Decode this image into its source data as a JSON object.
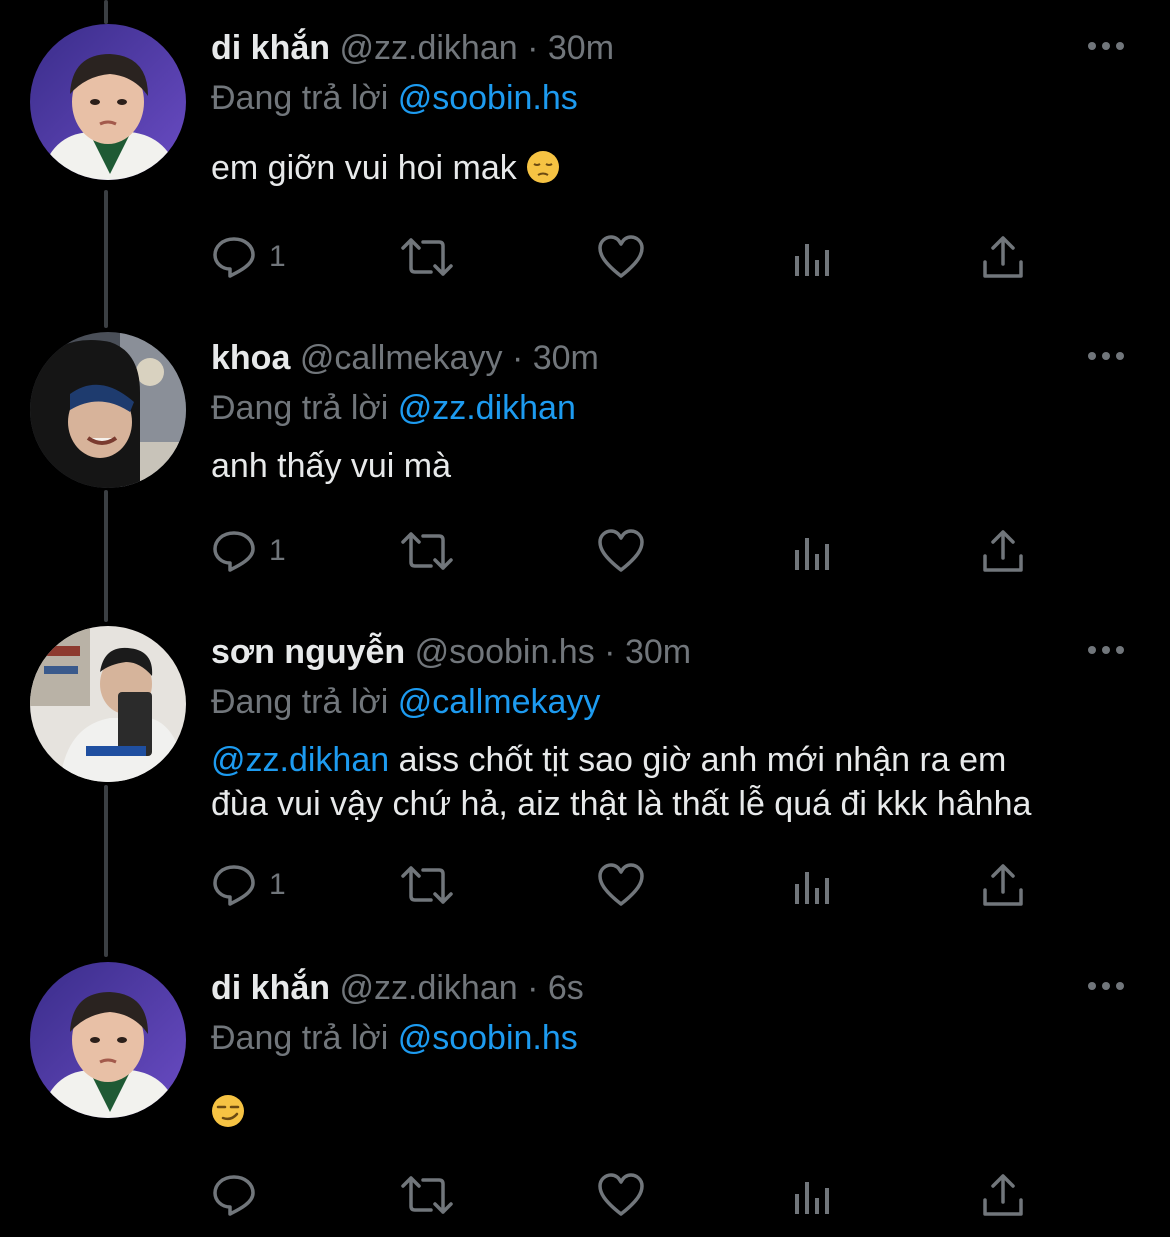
{
  "colors": {
    "background": "#000000",
    "text": "#e7e9ea",
    "muted": "#71767b",
    "mention": "#1d9bf0",
    "thread_line": "#3b3f43"
  },
  "tweets": [
    {
      "display_name": "di khắn",
      "handle": "@zz.dikhan",
      "separator": "·",
      "time": "30m",
      "reply_prefix": "Đang trả lời",
      "reply_to": "@soobin.hs",
      "text": "em giỡn vui hoi mak",
      "emoji": "pensive-face",
      "reply_count": "1",
      "avatar": "avatar-dikhan"
    },
    {
      "display_name": "khoa",
      "handle": "@callmekayy",
      "separator": "·",
      "time": "30m",
      "reply_prefix": "Đang trả lời",
      "reply_to": "@zz.dikhan",
      "text": "anh thấy vui mà",
      "reply_count": "1",
      "avatar": "avatar-khoa"
    },
    {
      "display_name": "sơn nguyễn",
      "handle": "@soobin.hs",
      "separator": "·",
      "time": "30m",
      "reply_prefix": "Đang trả lời",
      "reply_to": "@callmekayy",
      "text_mention": "@zz.dikhan",
      "text_line1": " aiss chốt tịt sao giờ anh mới nhận ra em",
      "text_line2": "đùa vui vậy chứ hả, aiz thật là thất lễ quá đi kkk hâhha",
      "reply_count": "1",
      "avatar": "avatar-soobin"
    },
    {
      "display_name": "di khắn",
      "handle": "@zz.dikhan",
      "separator": "·",
      "time": "6s",
      "reply_prefix": "Đang trả lời",
      "reply_to": "@soobin.hs",
      "emoji": "smirking-face",
      "reply_count": "",
      "avatar": "avatar-dikhan"
    }
  ],
  "icons": [
    "reply-icon",
    "retweet-icon",
    "like-icon",
    "views-icon",
    "share-icon",
    "more-icon"
  ]
}
